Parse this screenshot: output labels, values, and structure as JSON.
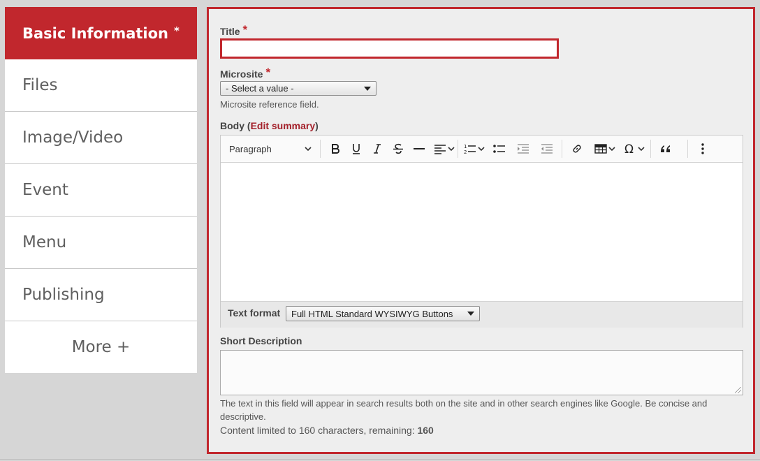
{
  "sidebar": {
    "items": [
      {
        "label": "Basic Information",
        "star": "*"
      },
      {
        "label": "Files"
      },
      {
        "label": "Image/Video"
      },
      {
        "label": "Event"
      },
      {
        "label": "Menu"
      },
      {
        "label": "Publishing"
      },
      {
        "label": "More +"
      }
    ]
  },
  "form": {
    "title_label": "Title",
    "required_mark": "*",
    "title_value": "",
    "microsite_label": "Microsite",
    "microsite_value": "- Select a value -",
    "microsite_help": "Microsite reference field.",
    "body_label": "Body",
    "body_paren_open": "(",
    "edit_summary": "Edit summary",
    "body_paren_close": ")",
    "toolbar": {
      "paragraph": "Paragraph",
      "buttons": [
        "bold-icon",
        "underline-icon",
        "italic-icon",
        "strikethrough-icon",
        "horizontal-line-icon",
        "align-icon",
        "numbered-list-icon",
        "bulleted-list-icon",
        "outdent-icon",
        "indent-icon",
        "link-icon",
        "table-icon",
        "special-characters-icon",
        "blockquote-icon",
        "more-options-icon"
      ]
    },
    "text_format_label": "Text format",
    "text_format_value": "Full HTML Standard WYSIWYG Buttons",
    "short_desc_label": "Short Description",
    "short_desc_help": "The text in this field will appear in search results both on the site and in other search engines like Google. Be concise and descriptive.",
    "limit_text": "Content limited to 160 characters, remaining: ",
    "remaining": "160"
  },
  "colors": {
    "accent": "#c1272d",
    "panel_bg": "#eeeeee",
    "page_bg": "#d6d6d6"
  }
}
